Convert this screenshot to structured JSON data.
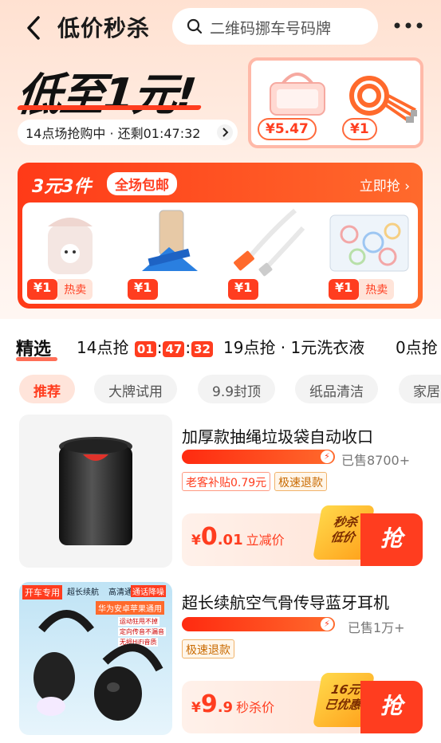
{
  "header": {
    "title": "低价秒杀",
    "search_placeholder": "二维码挪车号码牌",
    "icons": {
      "back": "back-arrow-icon",
      "search": "search-icon",
      "more": "more-dots-icon"
    }
  },
  "hero": {
    "headline": "低至1元!",
    "timer_text": "14点场抢购中 · 还剩01:47:32",
    "promo_prices": [
      "¥5.47",
      "¥1"
    ]
  },
  "deal": {
    "title": "3元3件",
    "badge": "全场包邮",
    "more": "立即抢 ›",
    "items": [
      {
        "price": "¥1",
        "hot": "热卖"
      },
      {
        "price": "¥1",
        "hot": ""
      },
      {
        "price": "¥1",
        "hot": ""
      },
      {
        "price": "¥1",
        "hot": "热卖"
      }
    ]
  },
  "tabs": {
    "selected": "精选",
    "t1": "14点抢",
    "cd": [
      "01",
      "47",
      "32"
    ],
    "t2": "19点抢 · 1元洗衣液",
    "t3": "0点抢"
  },
  "chips": [
    "推荐",
    "大牌试用",
    "9.9封顶",
    "纸品清洁",
    "家居"
  ],
  "items": [
    {
      "name": "加厚款抽绳垃圾袋自动收口",
      "sold": "已售8700+",
      "tags": [
        "老客补贴0.79元",
        "极速退款"
      ],
      "price_yen": "¥",
      "price_big": "0",
      "price_small": ".01",
      "price_label": "立减价",
      "flag1": "秒杀",
      "flag2": "低价",
      "grab": "抢"
    },
    {
      "name": "超长续航空气骨传导蓝牙耳机",
      "sold": "已售1万+",
      "tags": [
        "极速退款"
      ],
      "price_yen": "¥",
      "price_big": "9",
      "price_small": ".9",
      "price_label": "秒杀价",
      "flag1": "16元",
      "flag2": "已优惠",
      "grab": "抢",
      "thumb_badges": [
        "开车专用",
        "超长续航",
        "高清通话",
        "通话降噪",
        "华为安卓苹果通用",
        "运动狂甩不掉",
        "定向传音不漏音",
        "无损HiFi音质"
      ]
    }
  ],
  "colors": {
    "accent": "#ff3d1f",
    "accent2": "#ff6a2c",
    "bg_top": "#ffe1d1"
  }
}
